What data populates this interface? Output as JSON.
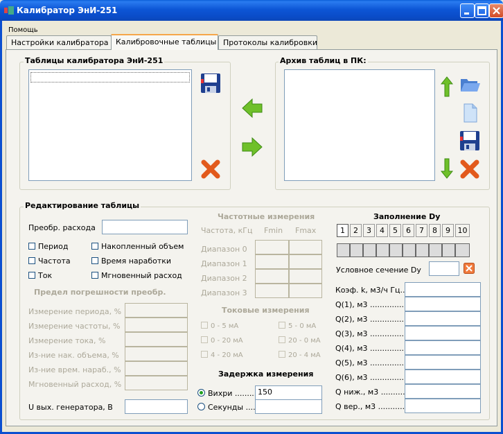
{
  "window": {
    "title": "Калибратор ЭнИ-251"
  },
  "menu": {
    "help": "Помощь"
  },
  "tabs": [
    {
      "label": "Настройки калибратора",
      "active": false
    },
    {
      "label": "Калибровочные таблицы",
      "active": true
    },
    {
      "label": "Протоколы калибровки",
      "active": false
    }
  ],
  "calibrator_tables": {
    "title": "Таблицы калибратора ЭнИ-251"
  },
  "pc_archive": {
    "title": "Архив таблиц в ПК:"
  },
  "edit": {
    "title": "Редактирование таблицы",
    "flow_conversion_label": "Преобр. расхода",
    "checkboxes": {
      "period": "Период",
      "accumulated_volume": "Накопленный объем",
      "frequency": "Частота",
      "operating_time": "Время наработки",
      "current": "Ток",
      "instant_flow": "Мгновенный расход"
    },
    "error_limit_title": "Предел погрешности преобр.",
    "error_rows": [
      "Измерение периода, %",
      "Измерение частоты, %",
      "Измерение тока, %",
      "Из-ние нак. объема, %",
      "Из-ние врем. нараб., %",
      "Мгновенный расход, %"
    ],
    "generator_voltage_label": "U вых. генератора, В"
  },
  "freq": {
    "title": "Частотные измерения",
    "header": {
      "freq": "Частота, кГц",
      "fmin": "Fmin",
      "fmax": "Fmax"
    },
    "ranges": [
      "Диапазон 0",
      "Диапазон 1",
      "Диапазон 2",
      "Диапазон 3"
    ]
  },
  "current": {
    "title": "Токовые измерения",
    "options": [
      "0 - 5 мА",
      "5 - 0 мА",
      "0 - 20 мА",
      "20 - 0 мА",
      "4 - 20 мА",
      "20 - 4 мА"
    ]
  },
  "delay": {
    "title": "Задержка измерения",
    "vortex_label": "Вихри ..........",
    "vortex_value": "150",
    "seconds_label": "Секунды ....."
  },
  "dy": {
    "title": "Заполнение Dy",
    "numbers": [
      "1",
      "2",
      "3",
      "4",
      "5",
      "6",
      "7",
      "8",
      "9",
      "10"
    ],
    "nominal_label": "Условное сечение Dy",
    "rows": [
      "Коэф. k, м3/ч Гц....",
      "Q(1), м3 ....................",
      "Q(2), м3 ....................",
      "Q(3), м3 ....................",
      "Q(4), м3 ....................",
      "Q(5), м3 ....................",
      "Q(6), м3 ....................",
      "Q ниж., м3 ...............",
      "Q вер., м3 ..............."
    ]
  },
  "icons": {
    "save": "floppy-save-icon",
    "delete": "red-x-icon",
    "left": "green-arrow-left-icon",
    "right": "green-arrow-right-icon",
    "up": "green-arrow-up-icon",
    "down": "green-arrow-down-icon",
    "open": "folder-open-icon",
    "new": "new-document-icon"
  }
}
